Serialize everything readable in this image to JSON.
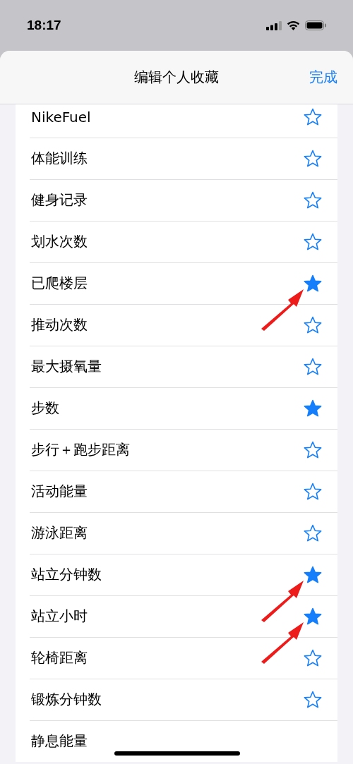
{
  "status_bar": {
    "time": "18:17"
  },
  "header": {
    "title": "编辑个人收藏",
    "done": "完成"
  },
  "rows": [
    {
      "label": "NikeFuel",
      "starred": false,
      "arrow": false
    },
    {
      "label": "体能训练",
      "starred": false,
      "arrow": false
    },
    {
      "label": "健身记录",
      "starred": false,
      "arrow": false
    },
    {
      "label": "划水次数",
      "starred": false,
      "arrow": false
    },
    {
      "label": "已爬楼层",
      "starred": true,
      "arrow": true
    },
    {
      "label": "推动次数",
      "starred": false,
      "arrow": false
    },
    {
      "label": "最大摄氧量",
      "starred": false,
      "arrow": false
    },
    {
      "label": "步数",
      "starred": true,
      "arrow": false
    },
    {
      "label": "步行＋跑步距离",
      "starred": false,
      "arrow": false
    },
    {
      "label": "活动能量",
      "starred": false,
      "arrow": false
    },
    {
      "label": "游泳距离",
      "starred": false,
      "arrow": false
    },
    {
      "label": "站立分钟数",
      "starred": true,
      "arrow": true
    },
    {
      "label": "站立小时",
      "starred": true,
      "arrow": true
    },
    {
      "label": "轮椅距离",
      "starred": false,
      "arrow": false
    },
    {
      "label": "锻炼分钟数",
      "starred": false,
      "arrow": false
    },
    {
      "label": "静息能量"
    }
  ]
}
